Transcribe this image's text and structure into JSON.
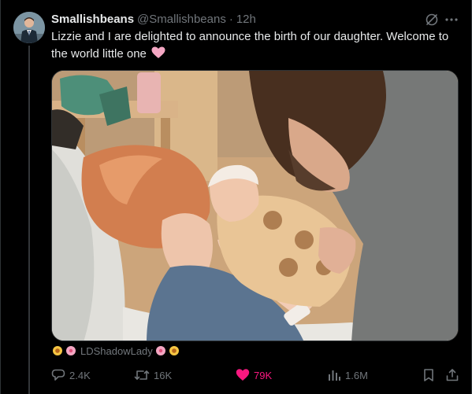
{
  "post": {
    "author_name": "Smallishbeans",
    "author_handle": "@Smallishbeans",
    "separator": "·",
    "timestamp": "12h",
    "text": "Lizzie and I are delighted to announce the birth of our daughter. Welcome to the world little one",
    "text_emoji": "pink-heart-icon"
  },
  "media": {
    "caption": "LDShadowLady"
  },
  "actions": {
    "replies": "2.4K",
    "reposts": "16K",
    "likes": "79K",
    "views": "1.6M"
  },
  "colors": {
    "background": "#000000",
    "text": "#e7e9ea",
    "muted": "#71767b",
    "like": "#f91880",
    "border": "#2f3336"
  }
}
